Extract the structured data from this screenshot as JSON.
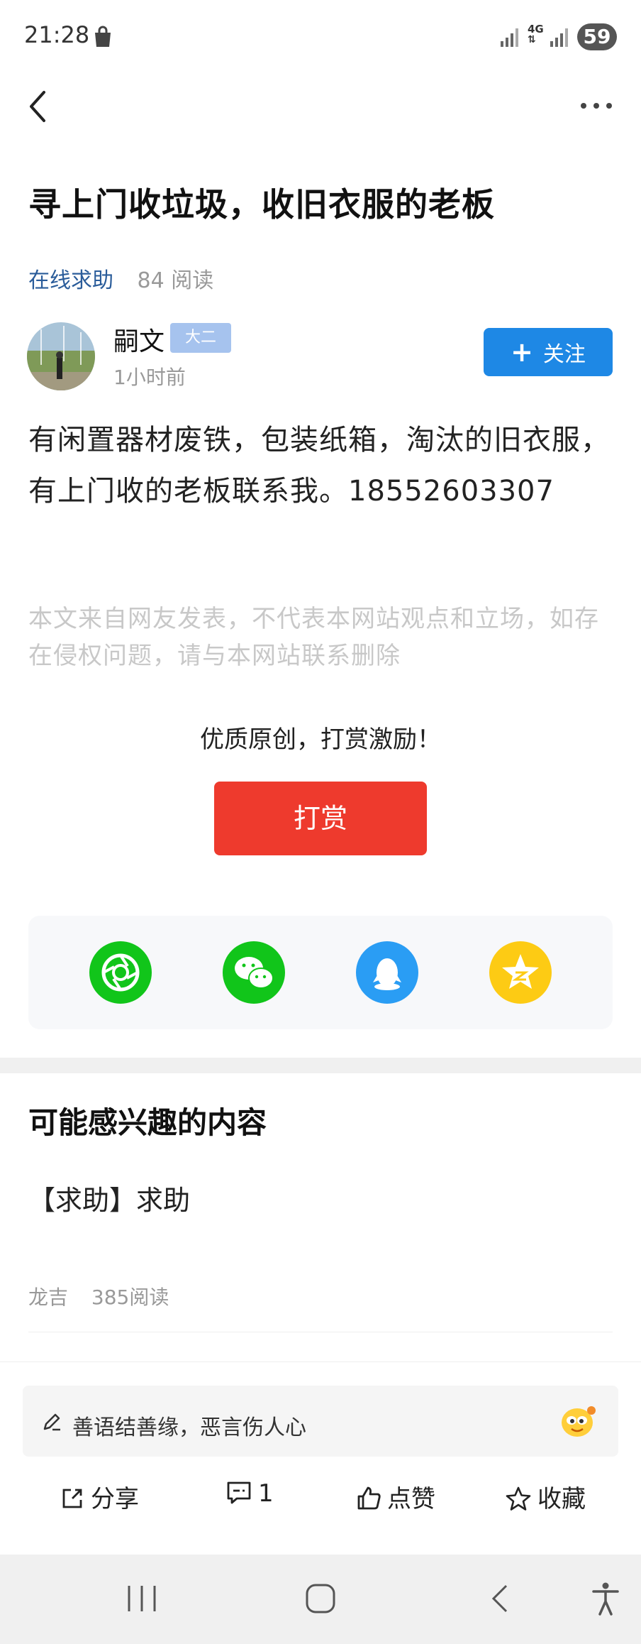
{
  "status_bar": {
    "time": "21:28",
    "network": "4G",
    "battery": "59"
  },
  "article": {
    "title": "寻上门收垃圾，收旧衣服的老板",
    "category": "在线求助",
    "reads": "84 阅读",
    "author": {
      "name": "嗣文",
      "badge": "大二",
      "time": "1小时前"
    },
    "follow_label": "关注",
    "content": "有闲置器材废铁，包装纸箱，淘汰的旧衣服，有上门收的老板联系我。18552603307",
    "disclaimer": "本文来自网友发表，不代表本网站观点和立场，如存在侵权问题，请与本网站联系删除"
  },
  "reward": {
    "prompt": "优质原创，打赏激励！",
    "button": "打赏"
  },
  "share": {
    "icons": [
      "moments-icon",
      "wechat-icon",
      "qq-icon",
      "qzone-icon"
    ],
    "colors": {
      "moments": "#11c51a",
      "wechat": "#11c51a",
      "qq": "#2a9df4",
      "qzone": "#fdcb14"
    }
  },
  "recommend": {
    "heading": "可能感兴趣的内容",
    "items": [
      {
        "title": "【求助】求助",
        "author": "龙吉",
        "reads": "385阅读"
      }
    ]
  },
  "bottom": {
    "comment_placeholder": "善语结善缘，恶言伤人心",
    "share": "分享",
    "comments": "1",
    "like": "点赞",
    "favorite": "收藏"
  },
  "colors": {
    "accent": "#1e88e5",
    "reward": "#ee3a2d",
    "category": "#2a5c9a"
  }
}
